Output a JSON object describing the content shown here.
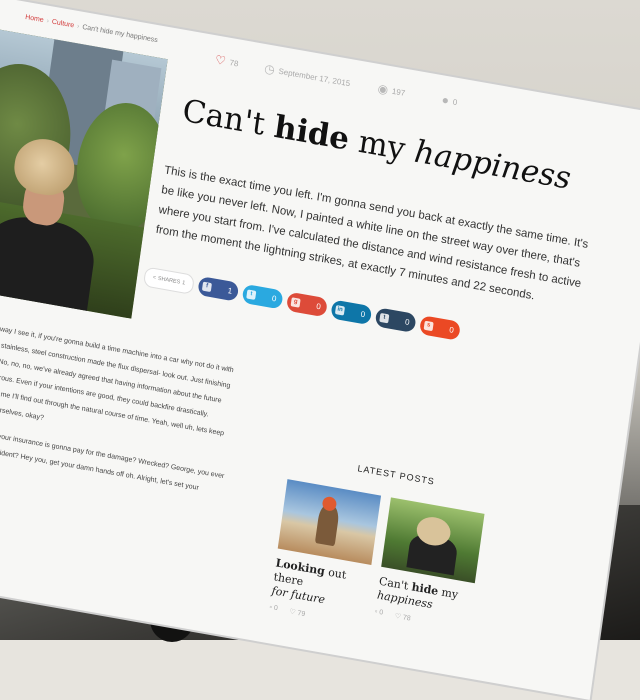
{
  "breadcrumb": {
    "home": "Home",
    "category": "Culture",
    "current": "Can't hide my happiness"
  },
  "meta": {
    "likes": "78",
    "date": "September 17, 2015",
    "views": "197",
    "comments": "0"
  },
  "post": {
    "title_pre": "Can't",
    "title_bold": "hide",
    "title_mid": "my",
    "title_italic": "happiness",
    "intro": "This is the exact time you left. I'm gonna send you back at exactly the same time. It's be like you never left. Now, I painted a white line on the street way over there, that's where you start from. I've calculated the distance and wind resistance fresh to active from the moment the lightning strikes, at exactly 7 minutes and 22 seconds."
  },
  "share": {
    "label": "SHARES",
    "count": "1",
    "buttons": [
      {
        "network": "facebook",
        "glyph": "f",
        "count": "1",
        "color": "#3b5998"
      },
      {
        "network": "twitter",
        "glyph": "t",
        "count": "0",
        "color": "#2aa9e0"
      },
      {
        "network": "google-plus",
        "glyph": "g",
        "count": "0",
        "color": "#dd4b39"
      },
      {
        "network": "linkedin",
        "glyph": "in",
        "count": "0",
        "color": "#0e76a8"
      },
      {
        "network": "tumblr",
        "glyph": "t",
        "count": "0",
        "color": "#2c4762"
      },
      {
        "network": "stumbleupon",
        "glyph": "s",
        "count": "0",
        "color": "#eb4924"
      }
    ]
  },
  "article_paragraphs": [
    "Well, what is it for? The way I see it, if you're gonna build a time machine into a car why not do it with some style. Besides, the stainless, steel construction made the flux dispersal- look out. Just finishing up the second coat now. No, no, no, we've already agreed that having information about the future could be extremely dangerous. Even if your intentions are good, they could backfire drastically. Whatever you've got to tell me I'll find out through the natural course of time. Yeah, well uh, lets keep this brain melting stuff to ourselves, okay?",
    "Ahh, um, can I assume that your insurance is gonna pay for the damage? Wrecked? George, you ever think of running for class president? Hey you, get your damn hands off oh. Alright, let's set your destination time. This is the"
  ],
  "latest": {
    "heading": "LATEST POSTS",
    "posts": [
      {
        "title_bold": "Looking",
        "title_rest": "out there",
        "title_italic": "for future",
        "comments": "0",
        "likes": "79"
      },
      {
        "title_pre": "Can't",
        "title_bold": "hide",
        "title_rest": "my",
        "title_italic": "happiness",
        "comments": "0",
        "likes": "78"
      }
    ]
  }
}
